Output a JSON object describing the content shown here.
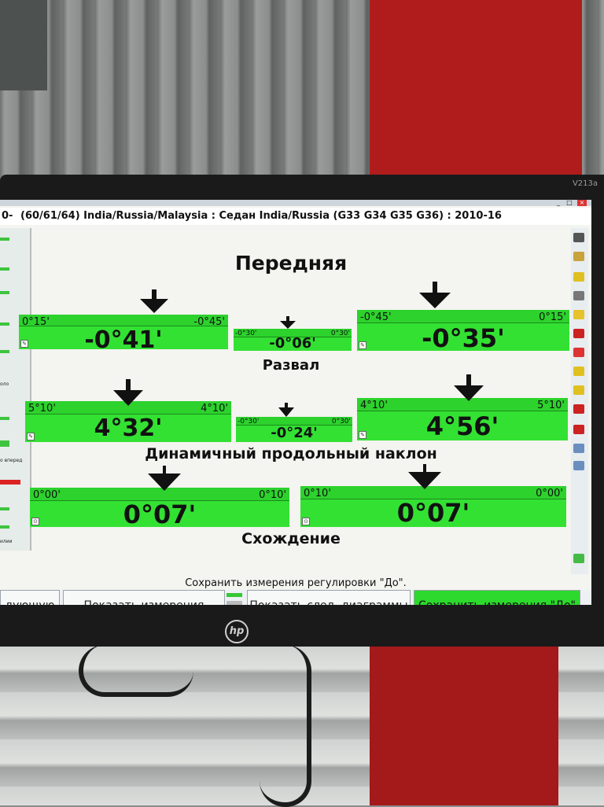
{
  "monitor": {
    "model": "V213a",
    "brand": "hp"
  },
  "header": {
    "prefix": "0-",
    "title": "(60/61/64) India/Russia/Malaysia : Седан India/Russia (G33 G34 G35 G36) : 2010-16"
  },
  "sections": {
    "front": "Передняя",
    "camber": "Развал",
    "caster": "Динамичный продольный наклон",
    "toe": "Схождение"
  },
  "camber": {
    "left": {
      "value": "-0°41'",
      "min": "0°15'",
      "max": "-0°45'"
    },
    "cross": {
      "value": "-0°06'",
      "min": "-0°30'",
      "max": "0°30'"
    },
    "right": {
      "value": "-0°35'",
      "min": "-0°45'",
      "max": "0°15'"
    }
  },
  "caster": {
    "left": {
      "value": "4°32'",
      "min": "5°10'",
      "max": "4°10'"
    },
    "cross": {
      "value": "-0°24'",
      "min": "-0°30'",
      "max": "0°30'"
    },
    "right": {
      "value": "4°56'",
      "min": "4°10'",
      "max": "5°10'"
    }
  },
  "toe": {
    "left": {
      "value": "0°07'",
      "min": "0°00'",
      "max": "0°10'"
    },
    "right": {
      "value": "0°07'",
      "min": "0°10'",
      "max": "0°00'"
    }
  },
  "left_panel": {
    "label_1": "оло",
    "label_2": "о вперед",
    "label_3": "илии"
  },
  "status_text": "Сохранить измерения регулировки \"До\".",
  "buttons": {
    "prev": "дующую",
    "show_measurements": "Показать измерения",
    "show_next_diagrams": "Показать след. диаграммы",
    "save_before": "Сохранить измерения \"До\""
  },
  "colors": {
    "gauge_green": "#33e133",
    "active_button": "#2cd92c"
  }
}
